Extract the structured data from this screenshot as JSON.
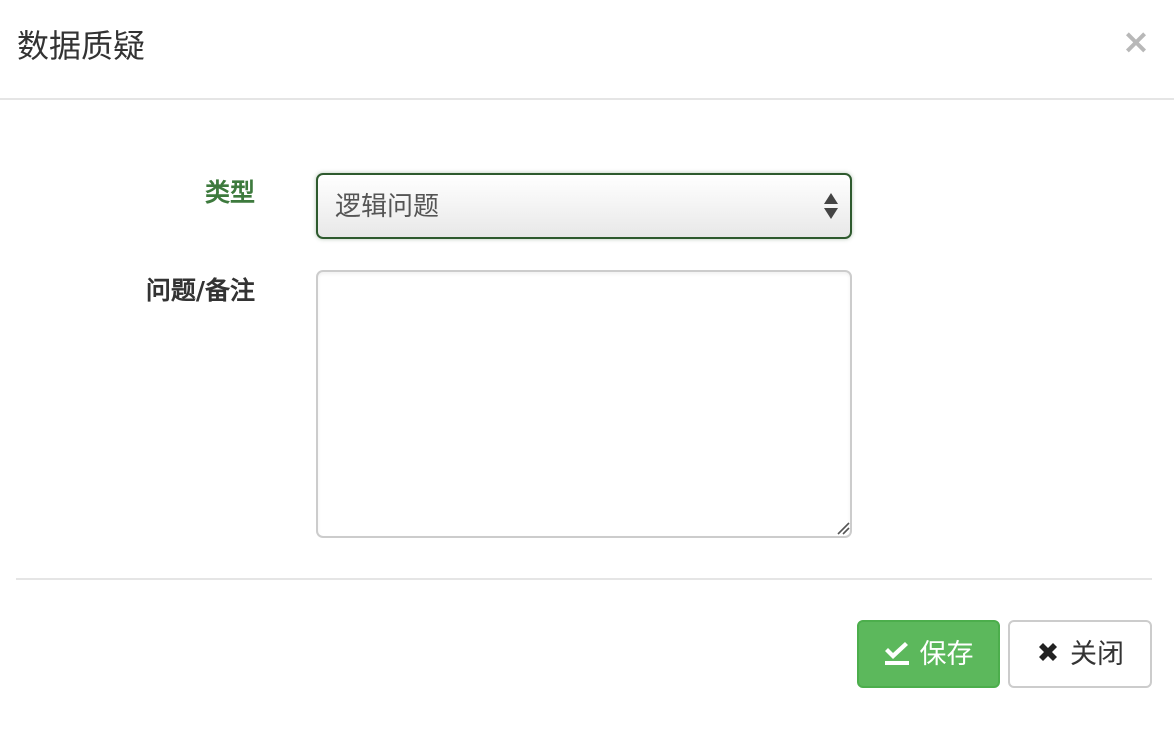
{
  "dialog": {
    "title": "数据质疑",
    "close_symbol": "×"
  },
  "form": {
    "type_label": "类型",
    "type_value": "逻辑问题",
    "note_label": "问题/备注",
    "note_value": ""
  },
  "footer": {
    "save_label": "保存",
    "close_label": "关闭"
  },
  "icons": {
    "save": "check-save-icon",
    "close": "x-mark-icon",
    "select": "select-updown-arrows-icon"
  },
  "colors": {
    "accent_green": "#5cb85c",
    "label_valid_green": "#3d7a3d",
    "select_border": "#2e5a2e"
  }
}
